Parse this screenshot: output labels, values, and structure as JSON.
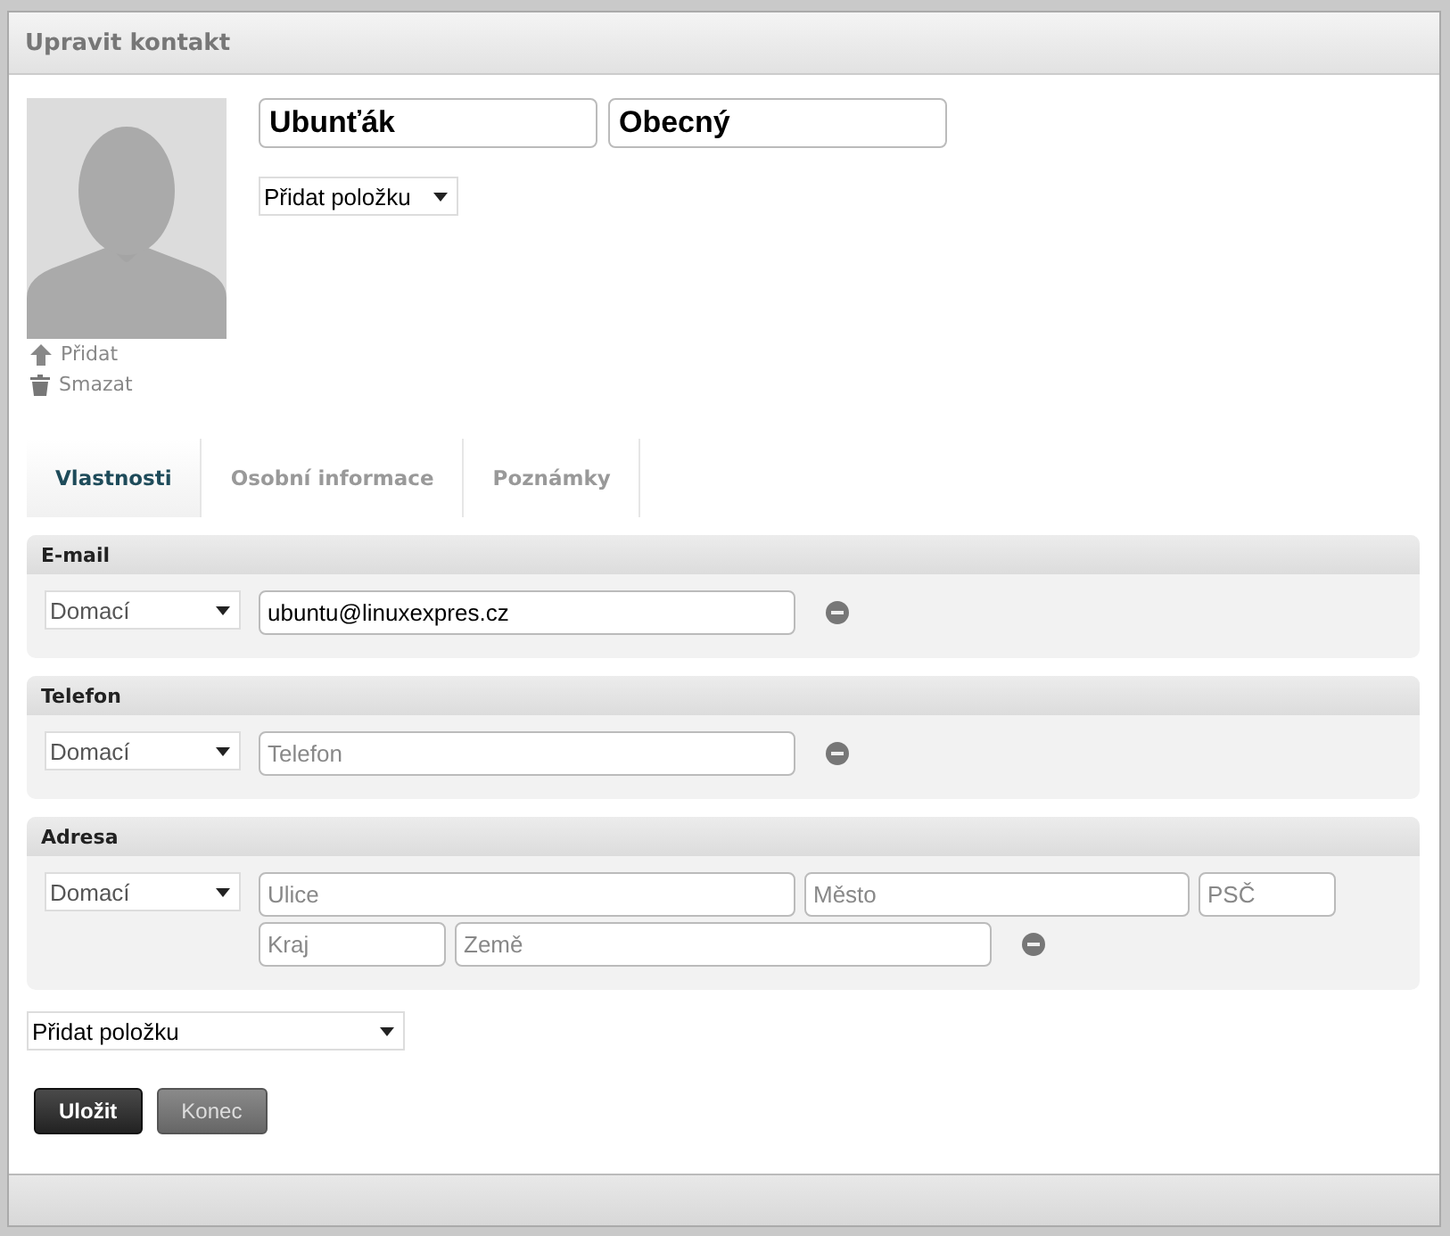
{
  "window": {
    "title": "Upravit kontakt"
  },
  "photo_actions": [
    {
      "kind": "upload",
      "label": "Přidat"
    },
    {
      "kind": "delete",
      "label": "Smazat"
    }
  ],
  "name_fields": [
    {
      "value": "Ubunťák"
    },
    {
      "value": "Obecný"
    }
  ],
  "add_item_top": {
    "value": "Přidat položku"
  },
  "tabs": [
    {
      "label": "Vlastnosti",
      "selected": true
    },
    {
      "label": "Osobní informace",
      "selected": false
    },
    {
      "label": "Poznámky",
      "selected": false
    }
  ],
  "sections": [
    {
      "title": "E-mail",
      "type_select": "Domací",
      "rows": [
        [
          {
            "value": "ubuntu@linuxexpres.cz"
          }
        ]
      ]
    },
    {
      "title": "Telefon",
      "type_select": "Domací",
      "rows": [
        [
          {
            "placeholder": "Telefon"
          }
        ]
      ]
    },
    {
      "title": "Adresa",
      "type_select": "Domací",
      "rows": [
        [
          {
            "placeholder": "Ulice"
          },
          {
            "placeholder": "Město"
          },
          {
            "placeholder": "PSČ"
          }
        ],
        [
          {
            "placeholder": "Kraj"
          },
          {
            "placeholder": "Země"
          }
        ]
      ]
    }
  ],
  "add_item_bottom": {
    "value": "Přidat položku"
  },
  "buttons": [
    {
      "label": "Uložit",
      "kind": "primary"
    },
    {
      "label": "Konec",
      "kind": "secondary"
    }
  ]
}
